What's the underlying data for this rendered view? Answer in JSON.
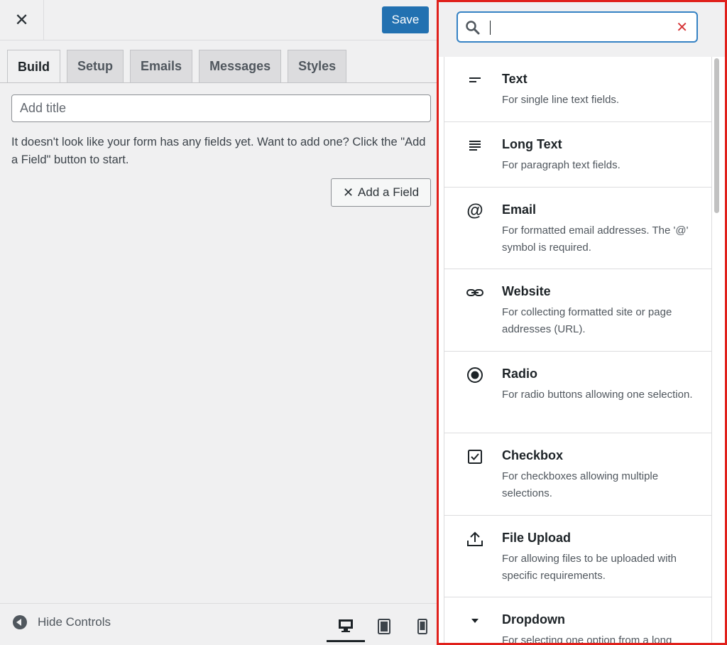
{
  "header": {
    "close_label": "✕",
    "save_label": "Save"
  },
  "tabs": [
    {
      "label": "Build",
      "active": true
    },
    {
      "label": "Setup",
      "active": false
    },
    {
      "label": "Emails",
      "active": false
    },
    {
      "label": "Messages",
      "active": false
    },
    {
      "label": "Styles",
      "active": false
    }
  ],
  "title_input": {
    "placeholder": "Add title",
    "value": ""
  },
  "empty_message": "It doesn't look like your form has any fields yet. Want to add one? Click the \"Add a Field\" button to start.",
  "add_field_label": "Add a Field",
  "footer": {
    "hide_controls_label": "Hide Controls",
    "devices": [
      {
        "icon": "desktop-icon",
        "active": true
      },
      {
        "icon": "tablet-icon",
        "active": false
      },
      {
        "icon": "mobile-icon",
        "active": false
      }
    ]
  },
  "field_picker": {
    "search": {
      "placeholder": "",
      "value": ""
    },
    "colors": {
      "accent": "#3582c4",
      "clear": "#d63638",
      "highlight_border": "#e0201b"
    },
    "items": [
      {
        "name": "Text",
        "desc": "For single line text fields.",
        "icon": "short-text-icon"
      },
      {
        "name": "Long Text",
        "desc": "For paragraph text fields.",
        "icon": "long-text-icon"
      },
      {
        "name": "Email",
        "desc": "For formatted email addresses. The '@' symbol is required.",
        "icon": "at-sign-icon"
      },
      {
        "name": "Website",
        "desc": "For collecting formatted site or page addresses (URL).",
        "icon": "link-icon"
      },
      {
        "name": "Radio",
        "desc": "For radio buttons allowing one selection.",
        "icon": "radio-icon"
      },
      {
        "name": "Checkbox",
        "desc": "For checkboxes allowing multiple selections.",
        "icon": "checkbox-icon"
      },
      {
        "name": "File Upload",
        "desc": "For allowing files to be uploaded with specific requirements.",
        "icon": "upload-icon"
      },
      {
        "name": "Dropdown",
        "desc": "For selecting one option from a long",
        "icon": "caret-down-icon"
      }
    ]
  }
}
